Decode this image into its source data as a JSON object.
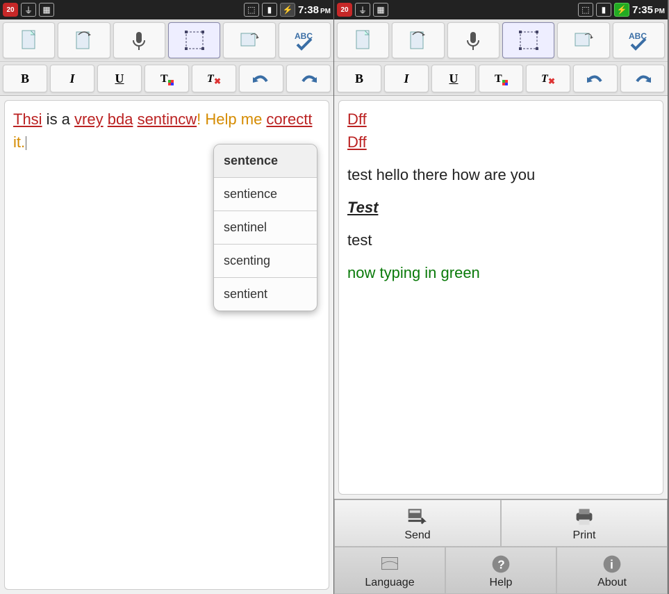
{
  "left": {
    "status": {
      "notif": "20",
      "time": "7:38",
      "ampm": "PM"
    },
    "editor": {
      "w1": "Thsi",
      "t1": " is a ",
      "w2": "vrey",
      "sp1": " ",
      "w3": "bda",
      "sp2": " ",
      "w4": "sentincw",
      "t2": "! Help me ",
      "w5": "corectt",
      "t3": " it."
    },
    "suggestions": [
      "sentence",
      "sentience",
      "sentinel",
      "scenting",
      "sentient"
    ]
  },
  "right": {
    "status": {
      "notif": "20",
      "time": "7:35",
      "ampm": "PM"
    },
    "editor": {
      "l1": "Dff",
      "l2": "Dff",
      "l3": "test hello there how are you",
      "l4": "Test",
      "l5": "test",
      "l6": "now typing in green"
    },
    "menu": {
      "send": "Send",
      "print": "Print",
      "language": "Language",
      "help": "Help",
      "about": "About"
    }
  },
  "fmt": {
    "bold": "B",
    "italic": "I",
    "underline": "U"
  },
  "abc": "ABC"
}
